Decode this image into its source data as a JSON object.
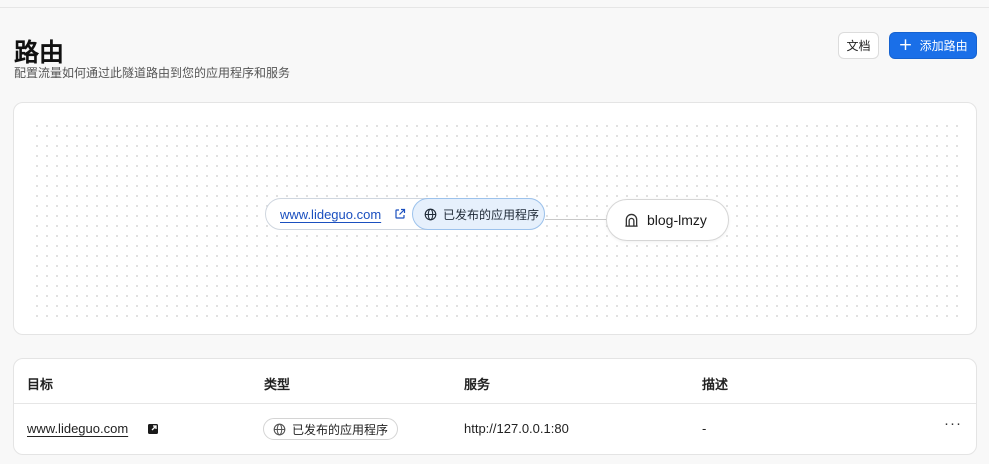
{
  "header": {
    "title": "路由",
    "subtitle": "配置流量如何通过此隧道路由到您的应用程序和服务",
    "docs_label": "文档",
    "add_label": "添加路由"
  },
  "diagram": {
    "target": "www.lideguo.com",
    "type_label": "已发布的应用程序",
    "service_name": "blog-lmzy"
  },
  "table": {
    "columns": [
      "目标",
      "类型",
      "服务",
      "描述"
    ],
    "rows": [
      {
        "target": "www.lideguo.com",
        "type": "已发布的应用程序",
        "service": "http://127.0.0.1:80",
        "description": "-",
        "actions": "···"
      }
    ]
  },
  "colors": {
    "accent": "#1a6fe8",
    "link": "#1a4fbf",
    "pill_bg": "#e6f0fc",
    "pill_border": "#9cc2ec"
  },
  "icons": [
    "plus-icon",
    "external-link-icon",
    "globe-icon",
    "tunnel-icon",
    "more-icon"
  ]
}
